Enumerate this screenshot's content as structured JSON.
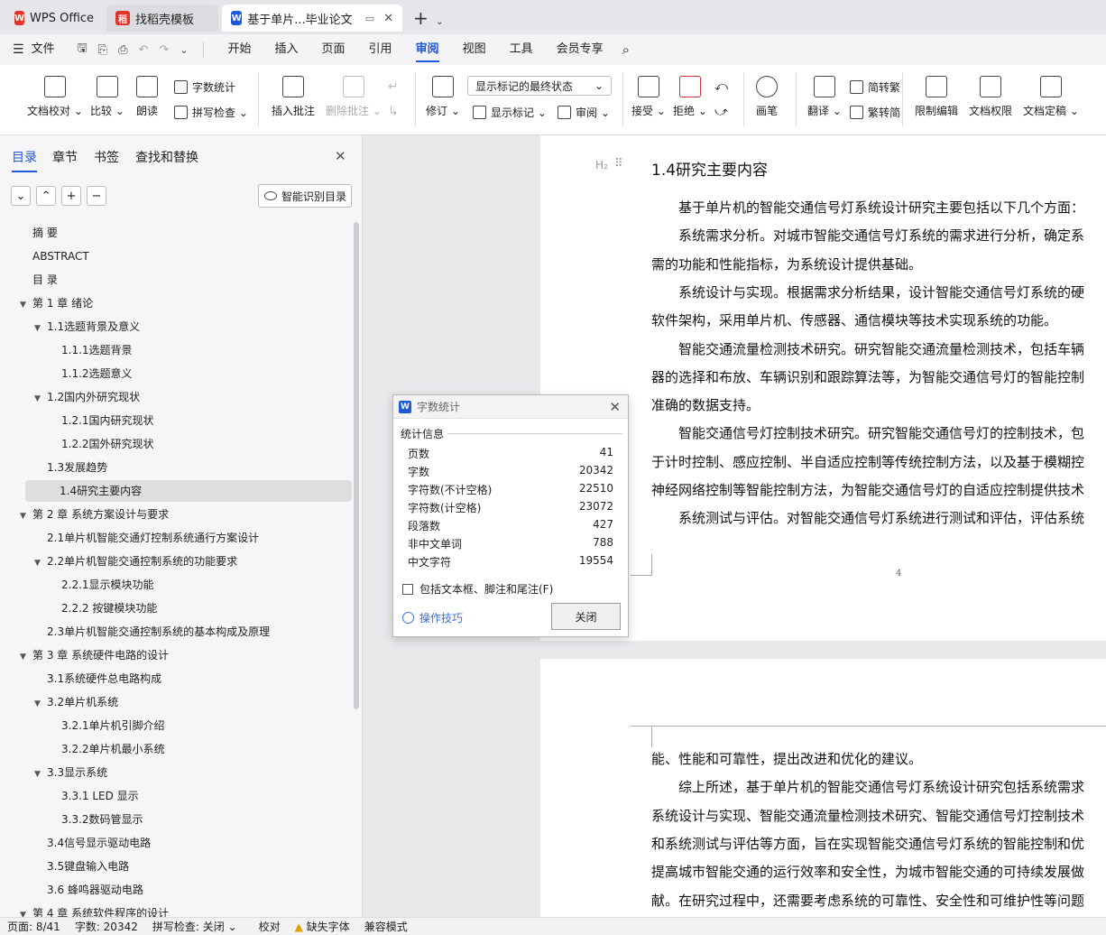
{
  "titlebar": {
    "tabs": [
      {
        "label": "WPS Office",
        "icon": "wps-logo-icon",
        "color": "#e0342b"
      },
      {
        "label": "找稻壳模板",
        "icon": "docer-icon",
        "color": "#e0342b"
      },
      {
        "label": "基于单片...毕业论文",
        "icon": "word-icon",
        "color": "#1f5bd8"
      }
    ],
    "new_tab": "+"
  },
  "menubar": {
    "file": "文件",
    "items": [
      "开始",
      "插入",
      "页面",
      "引用",
      "审阅",
      "视图",
      "工具",
      "会员专享"
    ],
    "active": "审阅"
  },
  "ribbon": {
    "doc_check": "文档校对",
    "compare": "比较",
    "read_aloud": "朗读",
    "word_count": "字数统计",
    "spell_check": "拼写检查",
    "insert_comment": "插入批注",
    "delete_comment": "删除批注",
    "revise": "修订",
    "markup_state": "显示标记的最终状态",
    "show_markup": "显示标记",
    "review": "审阅",
    "accept": "接受",
    "reject": "拒绝",
    "brush": "画笔",
    "translate": "翻译",
    "to_traditional": "简转繁",
    "to_simplified": "繁转简",
    "restrict_edit": "限制编辑",
    "doc_permission": "文档权限",
    "doc_finalize": "文档定稿"
  },
  "nav": {
    "tabs": [
      "目录",
      "章节",
      "书签",
      "查找和替换"
    ],
    "smart_toc": "智能识别目录",
    "toc": [
      {
        "label": "摘  要",
        "level": 1,
        "arrow": ""
      },
      {
        "label": "ABSTRACT",
        "level": 1,
        "arrow": ""
      },
      {
        "label": "目  录",
        "level": 1,
        "arrow": ""
      },
      {
        "label": "第 1 章  绪论",
        "level": 1,
        "arrow": "▼"
      },
      {
        "label": "1.1选题背景及意义",
        "level": 2,
        "arrow": "▼"
      },
      {
        "label": "1.1.1选题背景",
        "level": 3,
        "arrow": ""
      },
      {
        "label": "1.1.2选题意义",
        "level": 3,
        "arrow": ""
      },
      {
        "label": "1.2国内外研究现状",
        "level": 2,
        "arrow": "▼"
      },
      {
        "label": "1.2.1国内研究现状",
        "level": 3,
        "arrow": ""
      },
      {
        "label": "1.2.2国外研究现状",
        "level": 3,
        "arrow": ""
      },
      {
        "label": "1.3发展趋势",
        "level": 2,
        "arrow": ""
      },
      {
        "label": "1.4研究主要内容",
        "level": 2,
        "arrow": "",
        "selected": true
      },
      {
        "label": "第 2 章  系统方案设计与要求",
        "level": 1,
        "arrow": "▼"
      },
      {
        "label": "2.1单片机智能交通灯控制系统通行方案设计",
        "level": 2,
        "arrow": ""
      },
      {
        "label": "2.2单片机智能交通控制系统的功能要求",
        "level": 2,
        "arrow": "▼"
      },
      {
        "label": "2.2.1显示模块功能",
        "level": 3,
        "arrow": ""
      },
      {
        "label": "2.2.2  按键模块功能",
        "level": 3,
        "arrow": ""
      },
      {
        "label": "2.3单片机智能交通控制系统的基本构成及原理",
        "level": 2,
        "arrow": ""
      },
      {
        "label": "第 3 章  系统硬件电路的设计",
        "level": 1,
        "arrow": "▼"
      },
      {
        "label": "3.1系统硬件总电路构成",
        "level": 2,
        "arrow": ""
      },
      {
        "label": "3.2单片机系统",
        "level": 2,
        "arrow": "▼"
      },
      {
        "label": "3.2.1单片机引脚介绍",
        "level": 3,
        "arrow": ""
      },
      {
        "label": "3.2.2单片机最小系统",
        "level": 3,
        "arrow": ""
      },
      {
        "label": "3.3显示系统",
        "level": 2,
        "arrow": "▼"
      },
      {
        "label": "3.3.1 LED 显示",
        "level": 3,
        "arrow": ""
      },
      {
        "label": "3.3.2数码管显示",
        "level": 3,
        "arrow": ""
      },
      {
        "label": "3.4信号显示驱动电路",
        "level": 2,
        "arrow": ""
      },
      {
        "label": "3.5键盘输入电路",
        "level": 2,
        "arrow": ""
      },
      {
        "label": "3.6  蜂鸣器驱动电路",
        "level": 2,
        "arrow": ""
      },
      {
        "label": "第 4 章  系统软件程序的设计",
        "level": 1,
        "arrow": "▼"
      }
    ]
  },
  "document": {
    "heading_marker": "H₂",
    "heading": "1.4研究主要内容",
    "page1_lines": [
      {
        "text": "基于单片机的智能交通信号灯系统设计研究主要包括以下几个方面：",
        "indent": true
      },
      {
        "text": "系统需求分析。对城市智能交通信号灯系统的需求进行分析，确定系",
        "indent": true
      },
      {
        "text": "需的功能和性能指标，为系统设计提供基础。",
        "indent": false
      },
      {
        "text": "系统设计与实现。根据需求分析结果，设计智能交通信号灯系统的硬",
        "indent": true
      },
      {
        "text": "软件架构，采用单片机、传感器、通信模块等技术实现系统的功能。",
        "indent": false
      },
      {
        "text": "智能交通流量检测技术研究。研究智能交通流量检测技术，包括车辆",
        "indent": true
      },
      {
        "text": "器的选择和布放、车辆识别和跟踪算法等，为智能交通信号灯的智能控制",
        "indent": false
      },
      {
        "text": "准确的数据支持。",
        "indent": false
      },
      {
        "text": "智能交通信号灯控制技术研究。研究智能交通信号灯的控制技术，包",
        "indent": true
      },
      {
        "text": "于计时控制、感应控制、半自适应控制等传统控制方法，以及基于模糊控",
        "indent": false
      },
      {
        "text": "神经网络控制等智能控制方法，为智能交通信号灯的自适应控制提供技术",
        "indent": false
      },
      {
        "text": "系统测试与评估。对智能交通信号灯系统进行测试和评估，评估系统",
        "indent": true
      }
    ],
    "page_number": "4",
    "page2_lines": [
      {
        "text": "能、性能和可靠性，提出改进和优化的建议。",
        "indent": false
      },
      {
        "text": "综上所述，基于单片机的智能交通信号灯系统设计研究包括系统需求",
        "indent": true
      },
      {
        "text": "系统设计与实现、智能交通流量检测技术研究、智能交通信号灯控制技术",
        "indent": false
      },
      {
        "text": "和系统测试与评估等方面，旨在实现智能交通信号灯系统的智能控制和优",
        "indent": false
      },
      {
        "text": "提高城市智能交通的运行效率和安全性，为城市智能交通的可持续发展做",
        "indent": false
      },
      {
        "text": "献。在研究过程中，还需要考虑系统的可靠性、安全性和可维护性等问题",
        "indent": false
      }
    ]
  },
  "dialog": {
    "title": "字数统计",
    "section": "统计信息",
    "rows": [
      {
        "label": "页数",
        "value": "41"
      },
      {
        "label": "字数",
        "value": "20342"
      },
      {
        "label": "字符数(不计空格)",
        "value": "22510"
      },
      {
        "label": "字符数(计空格)",
        "value": "23072"
      },
      {
        "label": "段落数",
        "value": "427"
      },
      {
        "label": "非中文单词",
        "value": "788"
      },
      {
        "label": "中文字符",
        "value": "19554"
      }
    ],
    "checkbox": "包括文本框、脚注和尾注(F)",
    "tips": "操作技巧",
    "close": "关闭"
  },
  "status": {
    "page": "页面: 8/41",
    "words": "字数: 20342",
    "spell": "拼写检查: 关闭",
    "proofread": "校对",
    "missing_font": "缺失字体",
    "compat": "兼容模式"
  }
}
